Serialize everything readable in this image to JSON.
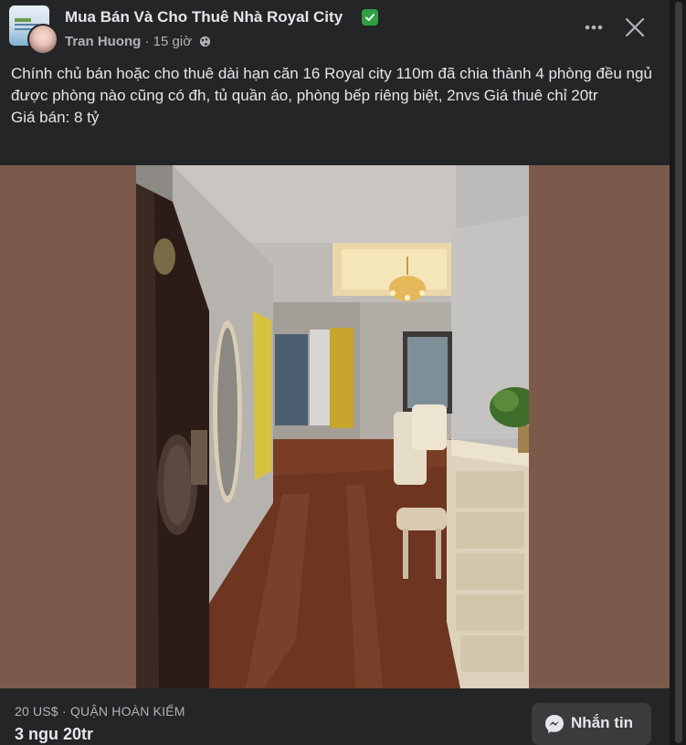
{
  "post": {
    "group_name": "Mua Bán Và Cho Thuê Nhà Royal City",
    "author": "Tran Huong",
    "separator": " · ",
    "time": "15 giờ",
    "body_line1": "Chính chủ bán hoặc cho thuê dài hạn căn 16 Royal city 110m đã chia thành 4 phòng đều ngủ được phòng nào cũng có đh, tủ quần áo, phòng bếp riêng biệt, 2nvs Giá thuê chỉ 20tr",
    "body_line2": "Giá bán: 8 tỷ"
  },
  "listing": {
    "price_location": "20 US$ · QUẬN HOÀN KIẾM",
    "title": "3 ngu 20tr",
    "message_button": "Nhắn tin"
  },
  "icons": {
    "verified": "verified-badge-icon",
    "privacy": "globe-icon",
    "more": "more-options-icon",
    "close": "close-icon",
    "messenger": "messenger-icon"
  },
  "colors": {
    "card_background": "#242526",
    "verified": "#2ea043",
    "photo_backdrop": "#7c5a4b",
    "button_background": "#3a3b3c"
  }
}
